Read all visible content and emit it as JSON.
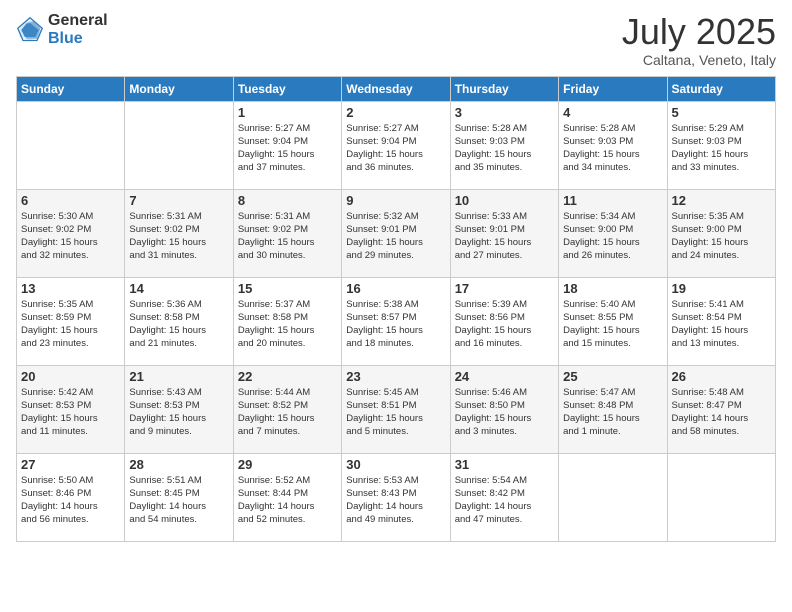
{
  "header": {
    "logo_general": "General",
    "logo_blue": "Blue",
    "title": "July 2025",
    "location": "Caltana, Veneto, Italy"
  },
  "weekdays": [
    "Sunday",
    "Monday",
    "Tuesday",
    "Wednesday",
    "Thursday",
    "Friday",
    "Saturday"
  ],
  "weeks": [
    [
      {
        "day": "",
        "info": ""
      },
      {
        "day": "",
        "info": ""
      },
      {
        "day": "1",
        "info": "Sunrise: 5:27 AM\nSunset: 9:04 PM\nDaylight: 15 hours\nand 37 minutes."
      },
      {
        "day": "2",
        "info": "Sunrise: 5:27 AM\nSunset: 9:04 PM\nDaylight: 15 hours\nand 36 minutes."
      },
      {
        "day": "3",
        "info": "Sunrise: 5:28 AM\nSunset: 9:03 PM\nDaylight: 15 hours\nand 35 minutes."
      },
      {
        "day": "4",
        "info": "Sunrise: 5:28 AM\nSunset: 9:03 PM\nDaylight: 15 hours\nand 34 minutes."
      },
      {
        "day": "5",
        "info": "Sunrise: 5:29 AM\nSunset: 9:03 PM\nDaylight: 15 hours\nand 33 minutes."
      }
    ],
    [
      {
        "day": "6",
        "info": "Sunrise: 5:30 AM\nSunset: 9:02 PM\nDaylight: 15 hours\nand 32 minutes."
      },
      {
        "day": "7",
        "info": "Sunrise: 5:31 AM\nSunset: 9:02 PM\nDaylight: 15 hours\nand 31 minutes."
      },
      {
        "day": "8",
        "info": "Sunrise: 5:31 AM\nSunset: 9:02 PM\nDaylight: 15 hours\nand 30 minutes."
      },
      {
        "day": "9",
        "info": "Sunrise: 5:32 AM\nSunset: 9:01 PM\nDaylight: 15 hours\nand 29 minutes."
      },
      {
        "day": "10",
        "info": "Sunrise: 5:33 AM\nSunset: 9:01 PM\nDaylight: 15 hours\nand 27 minutes."
      },
      {
        "day": "11",
        "info": "Sunrise: 5:34 AM\nSunset: 9:00 PM\nDaylight: 15 hours\nand 26 minutes."
      },
      {
        "day": "12",
        "info": "Sunrise: 5:35 AM\nSunset: 9:00 PM\nDaylight: 15 hours\nand 24 minutes."
      }
    ],
    [
      {
        "day": "13",
        "info": "Sunrise: 5:35 AM\nSunset: 8:59 PM\nDaylight: 15 hours\nand 23 minutes."
      },
      {
        "day": "14",
        "info": "Sunrise: 5:36 AM\nSunset: 8:58 PM\nDaylight: 15 hours\nand 21 minutes."
      },
      {
        "day": "15",
        "info": "Sunrise: 5:37 AM\nSunset: 8:58 PM\nDaylight: 15 hours\nand 20 minutes."
      },
      {
        "day": "16",
        "info": "Sunrise: 5:38 AM\nSunset: 8:57 PM\nDaylight: 15 hours\nand 18 minutes."
      },
      {
        "day": "17",
        "info": "Sunrise: 5:39 AM\nSunset: 8:56 PM\nDaylight: 15 hours\nand 16 minutes."
      },
      {
        "day": "18",
        "info": "Sunrise: 5:40 AM\nSunset: 8:55 PM\nDaylight: 15 hours\nand 15 minutes."
      },
      {
        "day": "19",
        "info": "Sunrise: 5:41 AM\nSunset: 8:54 PM\nDaylight: 15 hours\nand 13 minutes."
      }
    ],
    [
      {
        "day": "20",
        "info": "Sunrise: 5:42 AM\nSunset: 8:53 PM\nDaylight: 15 hours\nand 11 minutes."
      },
      {
        "day": "21",
        "info": "Sunrise: 5:43 AM\nSunset: 8:53 PM\nDaylight: 15 hours\nand 9 minutes."
      },
      {
        "day": "22",
        "info": "Sunrise: 5:44 AM\nSunset: 8:52 PM\nDaylight: 15 hours\nand 7 minutes."
      },
      {
        "day": "23",
        "info": "Sunrise: 5:45 AM\nSunset: 8:51 PM\nDaylight: 15 hours\nand 5 minutes."
      },
      {
        "day": "24",
        "info": "Sunrise: 5:46 AM\nSunset: 8:50 PM\nDaylight: 15 hours\nand 3 minutes."
      },
      {
        "day": "25",
        "info": "Sunrise: 5:47 AM\nSunset: 8:48 PM\nDaylight: 15 hours\nand 1 minute."
      },
      {
        "day": "26",
        "info": "Sunrise: 5:48 AM\nSunset: 8:47 PM\nDaylight: 14 hours\nand 58 minutes."
      }
    ],
    [
      {
        "day": "27",
        "info": "Sunrise: 5:50 AM\nSunset: 8:46 PM\nDaylight: 14 hours\nand 56 minutes."
      },
      {
        "day": "28",
        "info": "Sunrise: 5:51 AM\nSunset: 8:45 PM\nDaylight: 14 hours\nand 54 minutes."
      },
      {
        "day": "29",
        "info": "Sunrise: 5:52 AM\nSunset: 8:44 PM\nDaylight: 14 hours\nand 52 minutes."
      },
      {
        "day": "30",
        "info": "Sunrise: 5:53 AM\nSunset: 8:43 PM\nDaylight: 14 hours\nand 49 minutes."
      },
      {
        "day": "31",
        "info": "Sunrise: 5:54 AM\nSunset: 8:42 PM\nDaylight: 14 hours\nand 47 minutes."
      },
      {
        "day": "",
        "info": ""
      },
      {
        "day": "",
        "info": ""
      }
    ]
  ]
}
